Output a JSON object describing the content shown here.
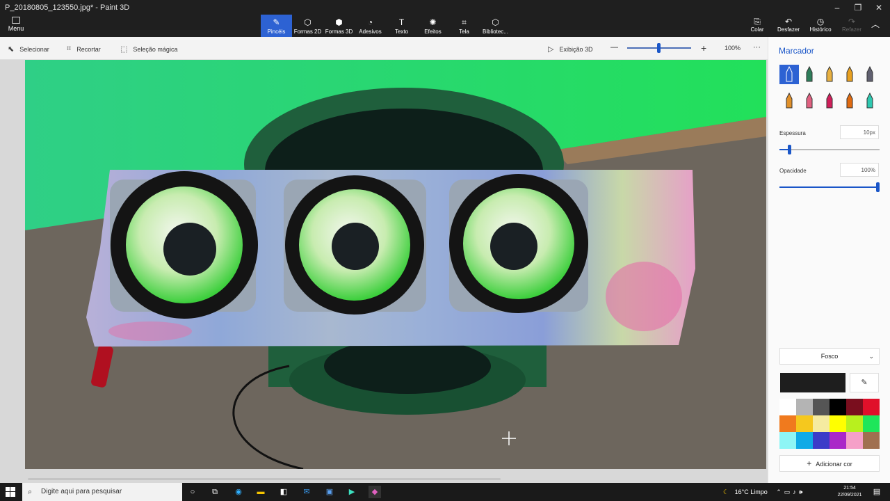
{
  "window": {
    "title": "P_20180805_123550.jpg* - Paint 3D",
    "minimize": "–",
    "maximize": "❐",
    "close": "✕"
  },
  "ribbon": {
    "menu_label": "Menu",
    "tools": [
      {
        "label": "Pincéis",
        "icon": "brush-icon",
        "glyph": "✎",
        "active": true
      },
      {
        "label": "Formas 2D",
        "icon": "shapes-2d-icon",
        "glyph": "⬡",
        "active": false
      },
      {
        "label": "Formas 3D",
        "icon": "shapes-3d-icon",
        "glyph": "⬢",
        "active": false
      },
      {
        "label": "Adesivos",
        "icon": "stickers-icon",
        "glyph": "◔",
        "active": false
      },
      {
        "label": "Texto",
        "icon": "text-icon",
        "glyph": "T",
        "active": false
      },
      {
        "label": "Efeitos",
        "icon": "effects-icon",
        "glyph": "✺",
        "active": false
      },
      {
        "label": "Tela",
        "icon": "canvas-icon",
        "glyph": "⌗",
        "active": false
      },
      {
        "label": "Bibliotec...",
        "icon": "library-icon",
        "glyph": "⬡",
        "active": false
      }
    ],
    "paste_label": "Colar",
    "undo_label": "Desfazer",
    "history_label": "Histórico",
    "redo_label": "Refazer",
    "collapse_glyph": "︿"
  },
  "toolbar": {
    "select_label": "Selecionar",
    "crop_label": "Recortar",
    "magic_select_label": "Seleção mágica",
    "view3d_label": "Exibição 3D",
    "zoom_out": "—",
    "zoom_in": "+",
    "zoom_value": "100%",
    "more": "···"
  },
  "panel": {
    "title": "Marcador",
    "thickness_label": "Espessura",
    "thickness_value": "10px",
    "thickness_fraction": 0.1,
    "opacity_label": "Opacidade",
    "opacity_value": "100%",
    "opacity_fraction": 1.0,
    "finish_value": "Fosco",
    "add_color_label": "Adicionar cor",
    "current_color": "#1e1e1e",
    "palette": [
      "#ffffff",
      "#b4b4b4",
      "#555555",
      "#000000",
      "#7a0e1e",
      "#e0102a",
      "#f07a1e",
      "#f5c81e",
      "#f5eba0",
      "#ffff00",
      "#b8f01e",
      "#1ee65a",
      "#8ef5f5",
      "#10aae6",
      "#3c3cc8",
      "#aa28c8",
      "#f5a0c8",
      "#a07050"
    ],
    "brushes": [
      {
        "name": "marker-icon",
        "color": "#ffffff",
        "selected": true
      },
      {
        "name": "calligraphy-pen-icon",
        "color": "#2e7d5a",
        "selected": false
      },
      {
        "name": "oil-brush-icon",
        "color": "#e8b040",
        "selected": false
      },
      {
        "name": "watercolor-icon",
        "color": "#e8a020",
        "selected": false
      },
      {
        "name": "pixel-pen-icon",
        "color": "#606070",
        "selected": false
      },
      {
        "name": "pencil-icon",
        "color": "#e0902a",
        "selected": false
      },
      {
        "name": "eraser-icon",
        "color": "#e06080",
        "selected": false
      },
      {
        "name": "crayon-icon",
        "color": "#d01e5a",
        "selected": false
      },
      {
        "name": "spray-can-icon",
        "color": "#e06a10",
        "selected": false
      },
      {
        "name": "fill-bucket-icon",
        "color": "#2ec8b0",
        "selected": false
      }
    ]
  },
  "taskbar": {
    "search_placeholder": "Digite aqui para pesquisar",
    "weather": "16°C  Limpo",
    "time": "21:54",
    "date": "22/09/2021"
  }
}
